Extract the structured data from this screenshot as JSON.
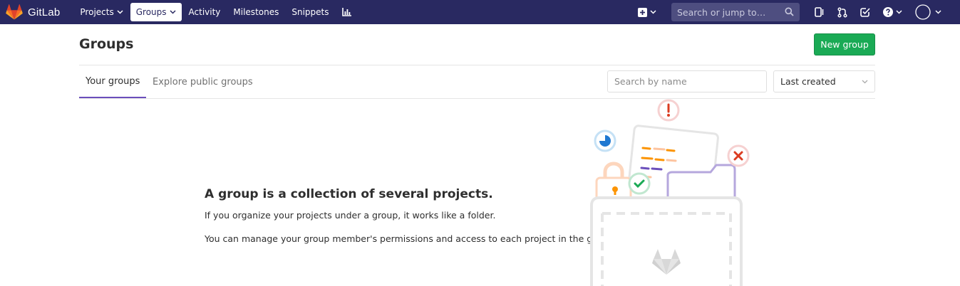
{
  "navbar": {
    "brand": "GitLab",
    "items": [
      {
        "label": "Projects",
        "dropdown": true
      },
      {
        "label": "Groups",
        "dropdown": true,
        "active": true
      },
      {
        "label": "Activity"
      },
      {
        "label": "Milestones"
      },
      {
        "label": "Snippets"
      }
    ],
    "search_placeholder": "Search or jump to…",
    "icons": [
      "chart-icon",
      "plus-square-icon",
      "search-icon",
      "issues-icon",
      "merge-request-icon",
      "todo-icon",
      "help-icon",
      "user-avatar-icon"
    ],
    "colors": {
      "background": "#292961",
      "search_bg": "#4e4e80"
    }
  },
  "page": {
    "title": "Groups",
    "new_button": "New group",
    "tabs": [
      {
        "label": "Your groups",
        "active": true
      },
      {
        "label": "Explore public groups",
        "active": false
      }
    ],
    "filter_placeholder": "Search by name",
    "sort_selected": "Last created",
    "colors": {
      "accent": "#6b4fbb",
      "success": "#1aaa55"
    }
  },
  "empty_state": {
    "title": "A group is a collection of several projects.",
    "line1": "If you organize your projects under a group, it works like a folder.",
    "line2": "You can manage your group member's permissions and access to each project in the group."
  }
}
